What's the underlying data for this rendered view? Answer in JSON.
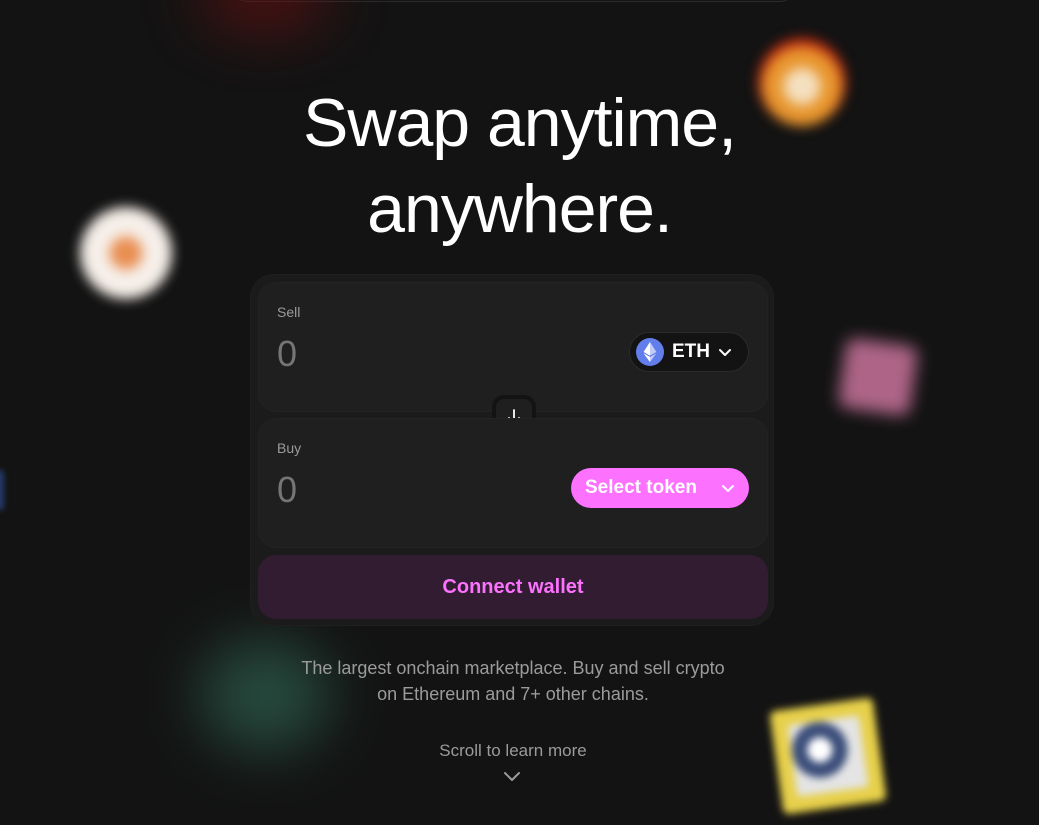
{
  "hero": {
    "title_line1": "Swap anytime,",
    "title_line2": "anywhere."
  },
  "swap": {
    "sell": {
      "label": "Sell",
      "amount_placeholder": "0",
      "token": "ETH",
      "token_icon": "ethereum-icon"
    },
    "buy": {
      "label": "Buy",
      "amount_placeholder": "0",
      "select_label": "Select token"
    },
    "switch_icon": "arrow-down-icon",
    "connect_label": "Connect wallet"
  },
  "subtitle": {
    "line1": "The largest onchain marketplace. Buy and sell crypto",
    "line2": "on Ethereum and 7+ other chains."
  },
  "scroll": {
    "label": "Scroll to learn more",
    "icon": "chevron-down-icon"
  },
  "colors": {
    "background": "#131313",
    "accent": "#fc72ff",
    "connect_bg": "#311c31",
    "eth": "#627eea"
  }
}
